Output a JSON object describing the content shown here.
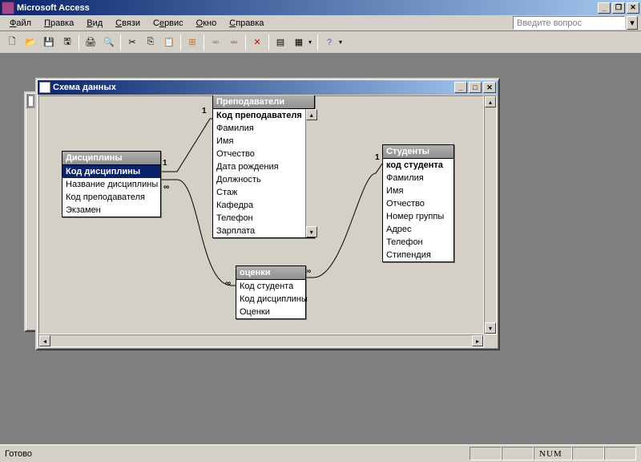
{
  "app": {
    "title": "Microsoft Access"
  },
  "menu": {
    "file": "Файл",
    "edit": "Правка",
    "view": "Вид",
    "relations": "Связи",
    "service": "Сервис",
    "window": "Окно",
    "help": "Справка"
  },
  "question_placeholder": "Введите вопрос",
  "child": {
    "title": "Схема данных"
  },
  "tables": {
    "disciplines": {
      "title": "Дисциплины",
      "fields": [
        "Код дисциплины",
        "Название дисциплины",
        "Код преподавателя",
        "Экзамен"
      ]
    },
    "teachers": {
      "title": "Преподаватели",
      "fields": [
        "Код преподавателя",
        "Фамилия",
        "Имя",
        "Отчество",
        "Дата рождения",
        "Должность",
        "Стаж",
        "Кафедра",
        "Телефон",
        "Зарплата"
      ]
    },
    "grades": {
      "title": "оценки",
      "fields": [
        "Код студента",
        "Код дисциплины",
        "Оценки"
      ]
    },
    "students": {
      "title": "Студенты",
      "fields": [
        "код студента",
        "Фамилия",
        "Имя",
        "Отчество",
        "Номер группы",
        "Адрес",
        "Телефон",
        "Стипендия"
      ]
    }
  },
  "rel_labels": {
    "one": "1",
    "many": "∞"
  },
  "status": {
    "ready": "Готово",
    "num": "NUM"
  }
}
